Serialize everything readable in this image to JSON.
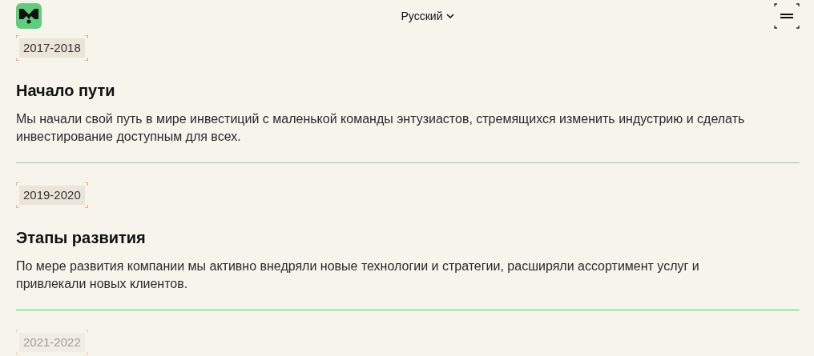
{
  "header": {
    "language": "Русский"
  },
  "timeline": [
    {
      "years": "2017-2018",
      "title": "Начало пути",
      "text": "Мы начали свой путь в мире инвестиций с маленькой команды энтузиастов, стремящихся изменить индустрию и сделать инвестирование доступным для всех.",
      "faded": false,
      "divider_active": false
    },
    {
      "years": "2019-2020",
      "title": "Этапы развития",
      "text": "По мере развития компании мы активно внедряли новые технологии и стратегии, расширяли ассортимент услуг и привлекали новых клиентов.",
      "faded": false,
      "divider_active": true
    },
    {
      "years": "2021-2022",
      "faded": true
    }
  ]
}
